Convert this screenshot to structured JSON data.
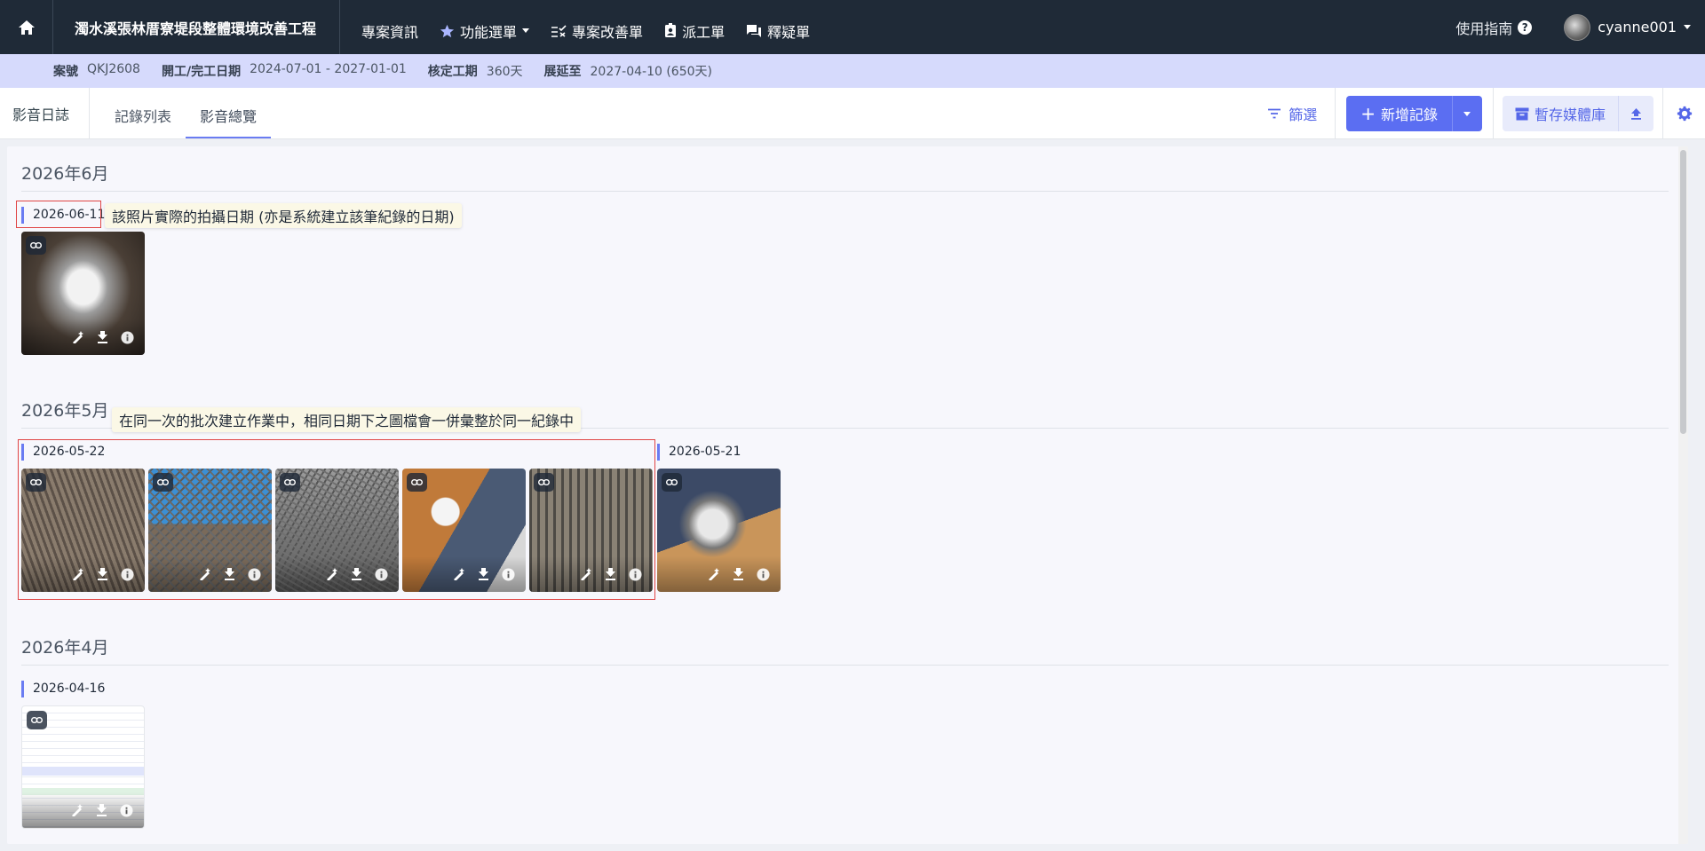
{
  "nav": {
    "project_title": "濁水溪張林厝寮堤段整體環境改善工程",
    "items": [
      {
        "label": "專案資訊"
      },
      {
        "label": "功能選單"
      },
      {
        "label": "專案改善單"
      },
      {
        "label": "派工單"
      },
      {
        "label": "釋疑單"
      }
    ],
    "guide_label": "使用指南",
    "username": "cyanne001"
  },
  "info": {
    "case_no_key": "案號",
    "case_no": "QKJ2608",
    "dates_key": "開工/完工日期",
    "dates": "2024-07-01 - 2027-01-01",
    "period_key": "核定工期",
    "period": "360天",
    "extend_key": "展延至",
    "extend": "2027-04-10 (650天)"
  },
  "subbar": {
    "section": "影音日誌",
    "tabs": [
      "記錄列表",
      "影音總覽"
    ],
    "active_tab": "影音總覽",
    "filter_label": "篩選",
    "add_label": "新增記錄",
    "store_label": "暫存媒體庫"
  },
  "gallery": {
    "months": [
      "2026年6月",
      "2026年5月",
      "2026年4月"
    ],
    "dates": [
      "2026-06-11",
      "2026-05-22",
      "2026-05-21",
      "2026-04-16"
    ],
    "callouts": [
      "該照片實際的拍攝日期 (亦是系統建立該筆紀錄的日期)",
      "在同一次的批次建立作業中，相同日期下之圖檔會一併彙整於同一紀錄中"
    ]
  },
  "colors": {
    "nav_bg": "#1f2a37",
    "info_bg": "#d6dafc",
    "accent": "#5b6ef2",
    "annotation_red": "#e04545"
  }
}
